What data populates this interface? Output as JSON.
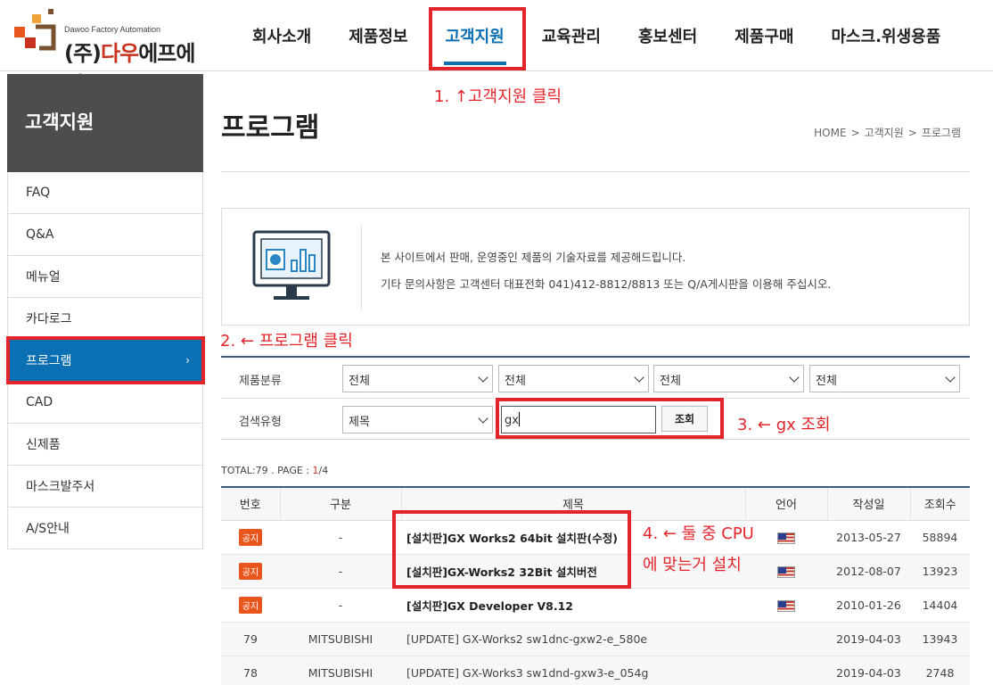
{
  "header": {
    "logo_small": "Dawoo Factory Automation",
    "logo_big_prefix": "(주)",
    "logo_big_red": "다우",
    "logo_big_rest": "에프에이",
    "nav": [
      "회사소개",
      "제품정보",
      "고객지원",
      "교육관리",
      "홍보센터",
      "제품구매",
      "마스크.위생용품"
    ],
    "active_nav": "고객지원"
  },
  "sidebar": {
    "title": "고객지원",
    "items": [
      "FAQ",
      "Q&A",
      "메뉴얼",
      "카다로그",
      "프로그램",
      "CAD",
      "신제품",
      "마스크발주서",
      "A/S안내"
    ],
    "active_item": "프로그램",
    "active_arrow": "›"
  },
  "main": {
    "title": "프로그램",
    "breadcrumb": [
      "HOME",
      "고객지원",
      "프로그램"
    ],
    "breadcrumb_sep": ">",
    "info_lines": [
      "본 사이트에서 판매, 운영중인 제품의 기술자료를 제공해드립니다.",
      "기타 문의사항은 고객센터 대표전화 041)412-8812/8813 또는 Q/A게시판을 이용해 주십시오."
    ]
  },
  "filter": {
    "category_label": "제품분류",
    "category_selects": [
      "전체",
      "전체",
      "전체",
      "전체"
    ],
    "search_type_label": "검색유형",
    "search_type_value": "제목",
    "search_value": "gx",
    "search_button": "조회"
  },
  "summary": {
    "prefix": "TOTAL:79 . PAGE : ",
    "current_page": "1",
    "total_pages": "/4"
  },
  "table": {
    "headers": [
      "번호",
      "구분",
      "제목",
      "언어",
      "작성일",
      "조회수"
    ],
    "notice_badge": "공지",
    "rows": [
      {
        "no": "",
        "notice": true,
        "category": "-",
        "title": "[설치판]GX Works2 64bit 설치판(수정)",
        "lang": "us-flag-icon",
        "date": "2013-05-27",
        "views": "58894"
      },
      {
        "no": "",
        "notice": true,
        "category": "-",
        "title": "[설치판]GX-Works2 32Bit 설치버전",
        "lang": "us-flag-icon",
        "date": "2012-08-07",
        "views": "13923"
      },
      {
        "no": "",
        "notice": true,
        "category": "-",
        "title": "[설치판]GX Developer V8.12",
        "lang": "us-flag-icon",
        "date": "2010-01-26",
        "views": "14404"
      },
      {
        "no": "79",
        "notice": false,
        "category": "MITSUBISHI",
        "title": "[UPDATE] GX-Works2 sw1dnc-gxw2-e_580e",
        "lang": "",
        "date": "2019-04-03",
        "views": "13943"
      },
      {
        "no": "78",
        "notice": false,
        "category": "MITSUBISHI",
        "title": "[UPDATE] GX-Works3 sw1dnd-gxw3-e_054g",
        "lang": "",
        "date": "2019-04-03",
        "views": "2748"
      }
    ]
  },
  "annotations": {
    "step1": "1. ↑고객지원 클릭",
    "step2": "2. ← 프로그램 클릭",
    "step3": "3. ← gx 조회",
    "step4_line1": "4. ← 둘 중 CPU",
    "step4_line2": "에 맞는거 설치",
    "color": "#e3242b"
  },
  "colors": {
    "brand_blue": "#0b6fb3",
    "sidebar_title_bg": "#4d4d4d",
    "logo_red": "#c8321e",
    "notice_badge": "#e8551d"
  }
}
